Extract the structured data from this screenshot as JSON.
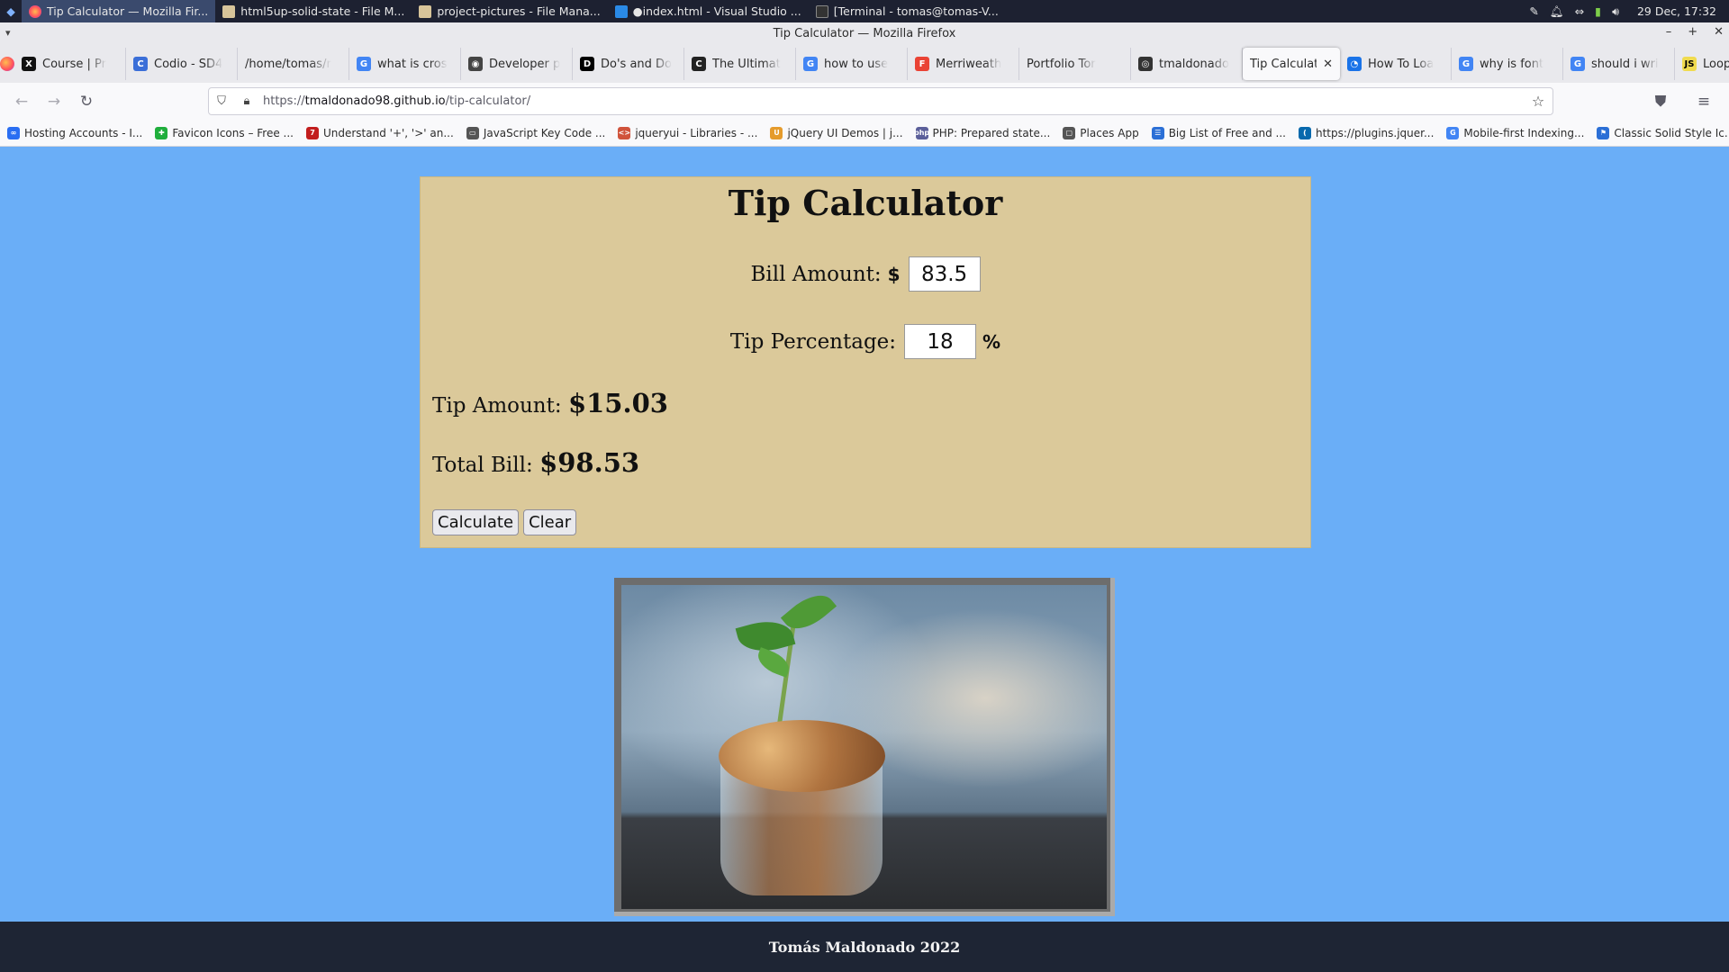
{
  "taskbar": {
    "tasks": [
      {
        "label": "Tip Calculator — Mozilla Fir...",
        "icon": "firefox-icon"
      },
      {
        "label": "html5up-solid-state - File M...",
        "icon": "folder-icon"
      },
      {
        "label": "project-pictures - File Mana...",
        "icon": "folder-icon"
      },
      {
        "label": "●index.html - Visual Studio ...",
        "icon": "vscode-icon"
      },
      {
        "label": "[Terminal - tomas@tomas-V...",
        "icon": "terminal-icon"
      }
    ],
    "clock": "29 Dec, 17:32"
  },
  "window": {
    "title": "Tip Calculator — Mozilla Firefox"
  },
  "tabs": [
    {
      "label": "Course | Pr",
      "icon": "x-icon",
      "color": "#111111",
      "glyph": "X"
    },
    {
      "label": "Codio - SD4",
      "icon": "codio-icon",
      "color": "#3b6fd8",
      "glyph": "C"
    },
    {
      "label": "/home/tomas/r",
      "icon": "",
      "color": "",
      "glyph": ""
    },
    {
      "label": "what is cros",
      "icon": "google-icon",
      "color": "#4285f4",
      "glyph": "G"
    },
    {
      "label": "Developer p",
      "icon": "developer-icon",
      "color": "#444444",
      "glyph": "◉"
    },
    {
      "label": "Do's and Do",
      "icon": "dev-icon",
      "color": "#000000",
      "glyph": "D"
    },
    {
      "label": "The Ultimat",
      "icon": "cf-icon",
      "color": "#222222",
      "glyph": "C"
    },
    {
      "label": "how to use",
      "icon": "google-icon",
      "color": "#4285f4",
      "glyph": "G"
    },
    {
      "label": "Merriweath",
      "icon": "fonts-icon",
      "color": "#ea4335",
      "glyph": "F"
    },
    {
      "label": "Portfolio Tor",
      "icon": "",
      "color": "",
      "glyph": ""
    },
    {
      "label": "tmaldonado",
      "icon": "github-icon",
      "color": "#333333",
      "glyph": "◎"
    },
    {
      "label": "Tip Calculator",
      "icon": "",
      "color": "",
      "glyph": "",
      "active": true
    },
    {
      "label": "How To Loa",
      "icon": "w3-icon",
      "color": "#1a73e8",
      "glyph": "◔"
    },
    {
      "label": "why is font",
      "icon": "google-icon",
      "color": "#4285f4",
      "glyph": "G"
    },
    {
      "label": "should i wri",
      "icon": "google-icon",
      "color": "#4285f4",
      "glyph": "G"
    },
    {
      "label": "Loops - Lear",
      "icon": "js-icon",
      "color": "#f0db4f",
      "glyph": "JS"
    }
  ],
  "url": {
    "prefix": "https://",
    "host": "tmaldonado98.github.io",
    "path": "/tip-calculator/"
  },
  "bookmarks": [
    {
      "label": "Hosting Accounts - I...",
      "icon": "hosting-icon",
      "color": "#2a6ef2",
      "glyph": "∞"
    },
    {
      "label": "Favicon Icons – Free ...",
      "icon": "favicon-icon",
      "color": "#1fae3c",
      "glyph": "✚"
    },
    {
      "label": "Understand '+', '>' an...",
      "icon": "t7-icon",
      "color": "#c21d1d",
      "glyph": "7"
    },
    {
      "label": "JavaScript Key Code ...",
      "icon": "keyboard-icon",
      "color": "#555555",
      "glyph": "▭"
    },
    {
      "label": "jqueryui - Libraries - ...",
      "icon": "code-icon",
      "color": "#d0533b",
      "glyph": "<>"
    },
    {
      "label": "jQuery UI Demos | j...",
      "icon": "jquery-icon",
      "color": "#e59b2c",
      "glyph": "U"
    },
    {
      "label": "PHP: Prepared state...",
      "icon": "php-icon",
      "color": "#5b5f9a",
      "glyph": "php"
    },
    {
      "label": "Places App",
      "icon": "folder-icon",
      "color": "#555555",
      "glyph": "▢"
    },
    {
      "label": "Big List of Free and ...",
      "icon": "list-icon",
      "color": "#2b6fd6",
      "glyph": "☰"
    },
    {
      "label": "https://plugins.jquer...",
      "icon": "jquery-plugin-icon",
      "color": "#0769ad",
      "glyph": "("
    },
    {
      "label": "Mobile-first Indexing...",
      "icon": "google-icon",
      "color": "#4285f4",
      "glyph": "G"
    },
    {
      "label": "Classic Solid Style Ic...",
      "icon": "flag-icon",
      "color": "#2b6fd6",
      "glyph": "⚑"
    }
  ],
  "calculator": {
    "title": "Tip Calculator",
    "bill_label": "Bill Amount:",
    "bill_currency": "$",
    "bill_value": "83.5",
    "tip_label": "Tip Percentage:",
    "tip_value": "18",
    "tip_unit": "%",
    "tip_amount_label": "Tip Amount:",
    "tip_amount_value": "$15.03",
    "total_label": "Total Bill:",
    "total_value": "$98.53",
    "calculate_button": "Calculate",
    "clear_button": "Clear"
  },
  "footer": {
    "text": "Tomás Maldonado 2022"
  },
  "colors": {
    "page_background": "#6aaef7",
    "card_background": "#dbc99a",
    "footer_background": "#1e2534"
  }
}
